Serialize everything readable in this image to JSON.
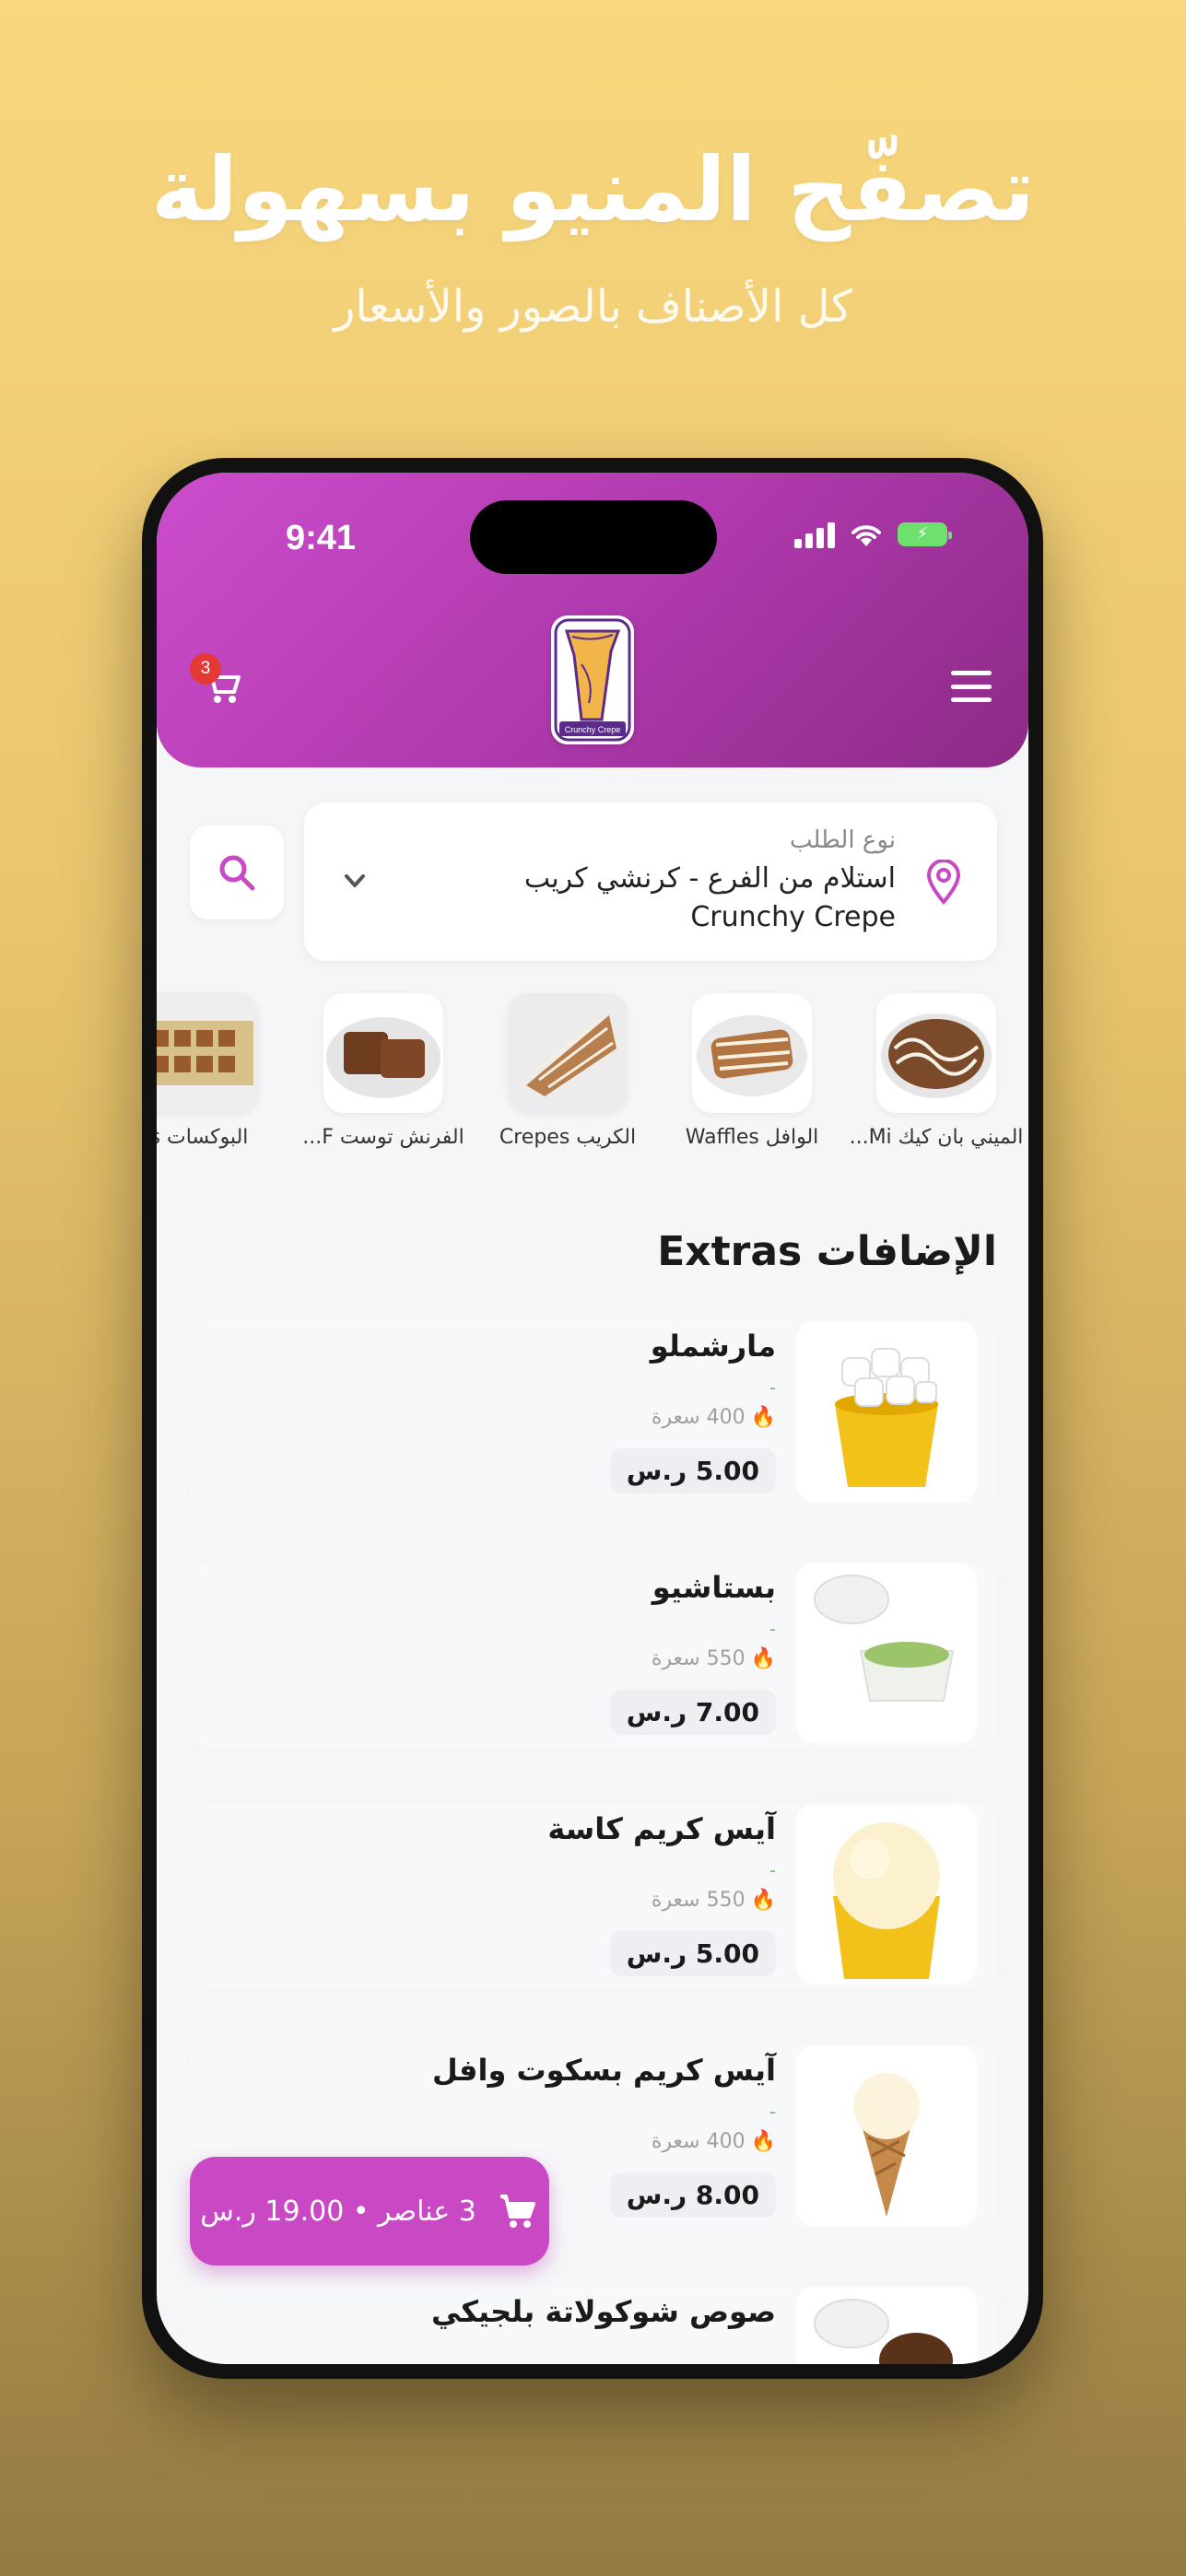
{
  "promo": {
    "title": "تصفّح المنيو بسهولة",
    "subtitle": "كل الأصناف بالصور والأسعار"
  },
  "status_bar": {
    "time": "9:41"
  },
  "header": {
    "cart_badge": "3",
    "logo_text": "Crunchy Crepe",
    "brand_color": "#c948c4"
  },
  "order_type": {
    "label": "نوع الطلب",
    "value": "استلام من الفرع - كرنشي كريب Crunchy Crepe"
  },
  "categories": [
    {
      "label": "الميني بان كيك Mi..."
    },
    {
      "label": "الوافل Waffles"
    },
    {
      "label": "الكريب Crepes"
    },
    {
      "label": "الفرنش توست F..."
    },
    {
      "label": "البوكسات s"
    }
  ],
  "section": {
    "title": "الإضافات Extras"
  },
  "items": [
    {
      "name": "مارشملو",
      "desc": "-",
      "calories": "400 سعرة",
      "price": "5.00 ر.س"
    },
    {
      "name": "بستاشيو",
      "desc": "-",
      "calories": "550 سعرة",
      "price": "7.00 ر.س"
    },
    {
      "name": "آيس كريم كاسة",
      "desc": "-",
      "calories": "550 سعرة",
      "price": "5.00 ر.س"
    },
    {
      "name": "آيس كريم بسكوت وافل",
      "desc": "-",
      "calories": "400 سعرة",
      "price": "8.00 ر.س"
    },
    {
      "name": "صوص شوكولاتة بلجيكي",
      "desc": "",
      "calories": "",
      "price": ""
    }
  ],
  "cart_fab": {
    "text": "3 عناصر • 19.00 ر.س"
  }
}
